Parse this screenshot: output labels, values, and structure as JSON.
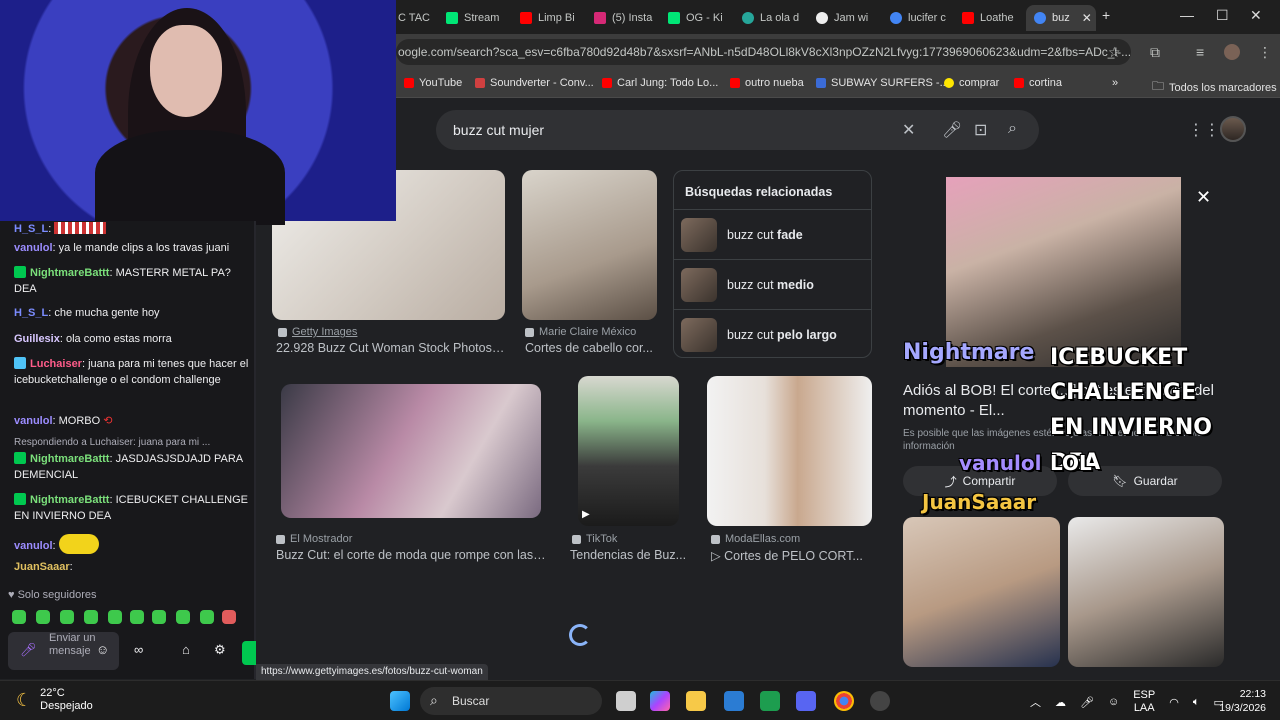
{
  "browser": {
    "tabs": [
      {
        "label": "C TAC"
      },
      {
        "label": "Stream"
      },
      {
        "label": "Limp Bi"
      },
      {
        "label": "(5) Insta"
      },
      {
        "label": "OG - Ki"
      },
      {
        "label": "La ola d"
      },
      {
        "label": "Jam wi"
      },
      {
        "label": "lucifer c"
      },
      {
        "label": "Loathe"
      },
      {
        "label": "buz"
      }
    ],
    "url": "oogle.com/search?sca_esv=c6fba780d92d48b7&sxsrf=ANbL-n5dD48OLl8kV8cXl3npOZzN2Lfvyg:1773969060623&udm=2&fbs=ADc_l-...",
    "bookmarks": [
      "YouTube",
      "Soundverter - Conv...",
      "Carl Jung: Todo Lo...",
      "outro nueba",
      "SUBWAY SURFERS -...",
      "comprar",
      "cortina"
    ],
    "all_bookmarks": "Todos los marcadores"
  },
  "google": {
    "query": "buzz cut mujer",
    "results": [
      {
        "source": "Getty Images",
        "title": "22.928 Buzz Cut Woman Stock Photos, ..."
      },
      {
        "source": "Marie Claire México",
        "title": "Cortes de cabello cor..."
      },
      {
        "source": "El Mostrador",
        "title": "Buzz Cut: el corte de moda que rompe con las b..."
      },
      {
        "source": "TikTok",
        "title": "Tendencias de Buz..."
      },
      {
        "source": "ModaEllas.com",
        "title": "▷ Cortes de PELO CORT..."
      }
    ],
    "related_header": "Búsquedas relacionadas",
    "related": [
      {
        "prefix": "buzz cut ",
        "bold": "fade"
      },
      {
        "prefix": "buzz cut ",
        "bold": "medio"
      },
      {
        "prefix": "buzz cut ",
        "bold": "pelo largo"
      }
    ],
    "panel": {
      "title": "Adiós al BOB! El corte [...] cut es el favorito del momento - El...",
      "note": "Es posible que las imágenes estén sujetas a derechos de autor. Más información",
      "share": "Compartir",
      "save": "Guardar"
    },
    "status_url": "https://www.gettyimages.es/fotos/buzz-cut-woman"
  },
  "chat": {
    "messages": [
      {
        "user": "H_S_L",
        "text": ""
      },
      {
        "user": "vanulol",
        "text": "ya le mande clips a los travas juani"
      },
      {
        "user": "NightmareBattt",
        "text": "MASTERR METAL PA? DEA"
      },
      {
        "user": "H_S_L",
        "text": "che mucha gente hoy"
      },
      {
        "user": "Guillesix",
        "text": "ola como estas morra"
      },
      {
        "user": "Luchaiser",
        "text": "juana para mi tenes que hacer el icebucketchallenge o el condom challenge"
      },
      {
        "user": "vanulol",
        "text": "MORBO"
      },
      {
        "user": "NightmareBattt",
        "text": "JASDJASJSDJAJD PARA DEMENCIAL"
      },
      {
        "user": "NightmareBattt",
        "text": "ICEBUCKET CHALLENGE EN INVIERNO DEA"
      },
      {
        "user": "vanulol",
        "text": ""
      },
      {
        "user": "JuanSaaar",
        "text": ""
      }
    ],
    "reply_to": "Respondiendo a Luchaiser: juana para mi ...",
    "followers_only": "Solo seguidores",
    "input_placeholder": "Enviar un mensaje"
  },
  "overlay": {
    "alert_user": "Nightmare",
    "alert_text": "ICEBUCKET CHALLENGE EN INVIERNO DEA",
    "user2": "vanulol",
    "text2": "LOL",
    "user3": "JuanSaaar"
  },
  "taskbar": {
    "temp": "22°C",
    "weather": "Despejado",
    "search": "Buscar",
    "lang": "ESP",
    "lang2": "LAA",
    "time": "22:13",
    "date": "19/3/2026"
  }
}
